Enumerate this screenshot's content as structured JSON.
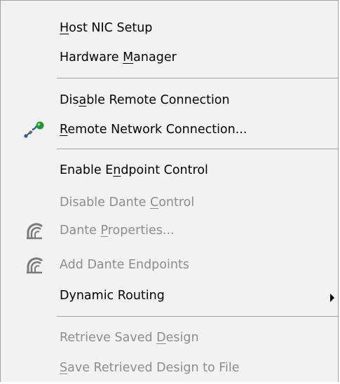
{
  "menu": {
    "items": [
      {
        "pre": "",
        "key": "H",
        "post": "ost NIC Setup",
        "enabled": true
      },
      {
        "pre": "Hardware ",
        "key": "M",
        "post": "anager",
        "enabled": true
      },
      {
        "pre": "Dis",
        "key": "a",
        "post": "ble Remote Connection",
        "enabled": true
      },
      {
        "pre": "",
        "key": "R",
        "post": "emote Network Connection...",
        "enabled": true,
        "icon": "remote-network-icon"
      },
      {
        "pre": "Enable E",
        "key": "n",
        "post": "dpoint Control",
        "enabled": true
      },
      {
        "pre": "Disable Dante ",
        "key": "C",
        "post": "ontrol",
        "enabled": false
      },
      {
        "pre": "Dante ",
        "key": "P",
        "post": "roperties...",
        "enabled": false,
        "icon": "dante-icon"
      },
      {
        "pre": "Add Dante Endpoints",
        "key": "",
        "post": "",
        "enabled": false,
        "icon": "dante-icon"
      },
      {
        "pre": "Dynamic Routing",
        "key": "",
        "post": "",
        "enabled": true,
        "submenu": true
      },
      {
        "pre": "Retrieve Saved ",
        "key": "D",
        "post": "esign",
        "enabled": false
      },
      {
        "pre": "",
        "key": "S",
        "post": "ave Retrieved Design to File",
        "enabled": false
      }
    ]
  },
  "colors": {
    "menu_background": "#f2f2f2",
    "disabled_text": "#8d8d8d",
    "separator": "#a0a0a0",
    "icon_blue": "#1f5fa8",
    "icon_green": "#1e9a2a"
  }
}
